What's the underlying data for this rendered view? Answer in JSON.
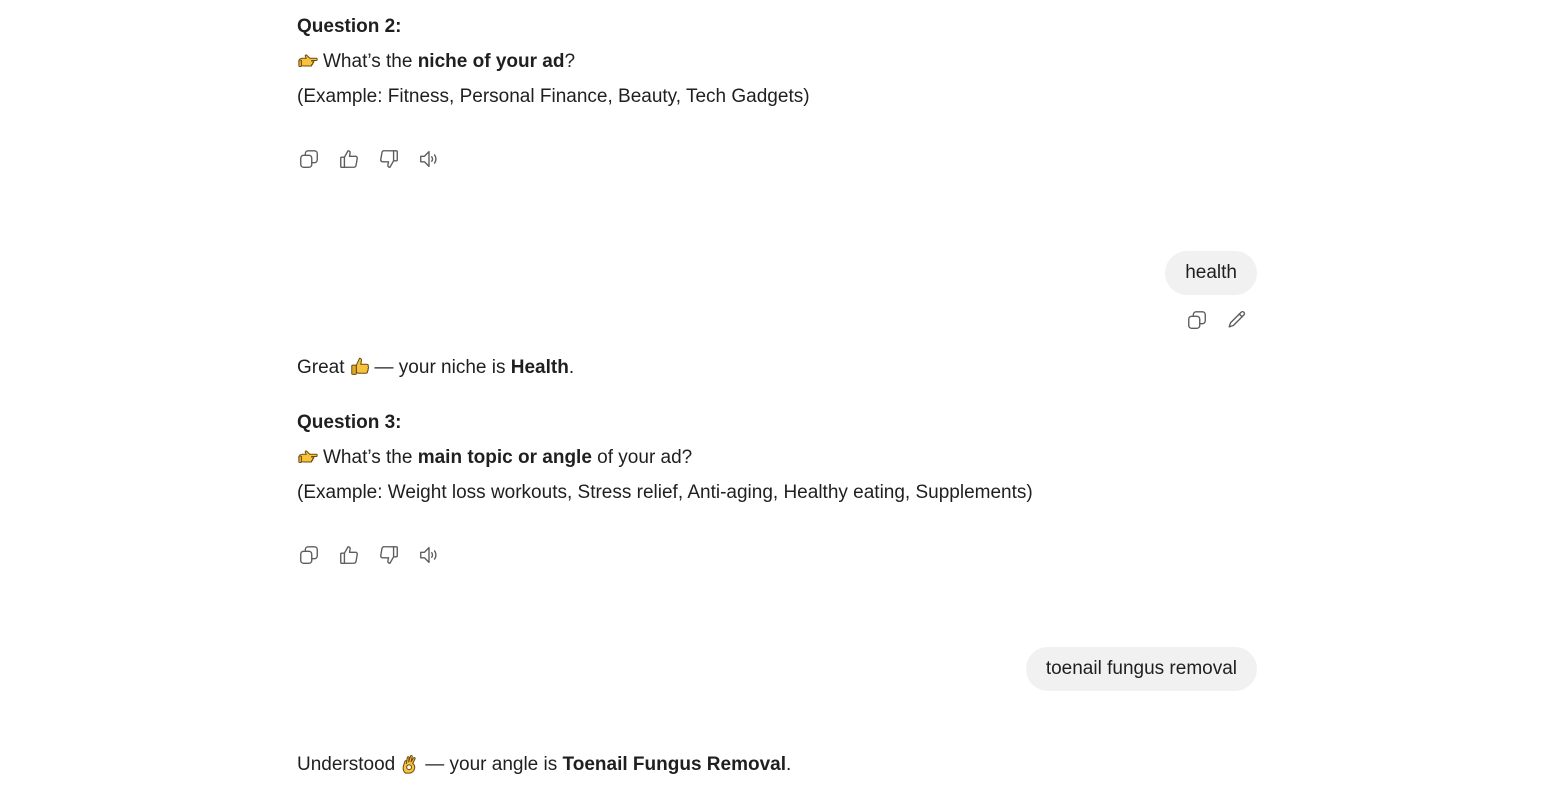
{
  "messages": {
    "q2": {
      "heading": "Question 2:",
      "prompt_pre": "What’s the ",
      "prompt_bold": "niche of your ad",
      "prompt_post": "?",
      "example": "(Example: Fitness, Personal Finance, Beauty, Tech Gadgets)"
    },
    "user1": {
      "text": "health"
    },
    "reply1": {
      "pre": "Great",
      "mid": "— your niche is ",
      "bold": "Health",
      "post": "."
    },
    "q3": {
      "heading": "Question 3:",
      "prompt_pre": "What’s the ",
      "prompt_bold": "main topic or angle",
      "prompt_post": " of your ad?",
      "example": "(Example: Weight loss workouts, Stress relief, Anti-aging, Healthy eating, Supplements)"
    },
    "user2": {
      "text": "toenail fungus removal"
    },
    "reply2": {
      "pre": "Understood",
      "mid": "— your angle is ",
      "bold": "Toenail Fungus Removal",
      "post": "."
    }
  },
  "icons": {
    "pointing_hand": "backhand-index-pointing-right-icon",
    "thumbs_up_emoji": "thumbs-up-emoji-icon",
    "ok_hand_emoji": "ok-hand-emoji-icon",
    "copy": "copy-icon",
    "like": "thumbs-up-icon",
    "dislike": "thumbs-down-icon",
    "read_aloud": "speaker-icon",
    "edit": "pencil-icon"
  },
  "colors": {
    "bubble_bg": "#f1f1f1",
    "text": "#1f1f1f",
    "icon": "#5d5d5d",
    "emoji_yellow": "#f7c23c"
  }
}
